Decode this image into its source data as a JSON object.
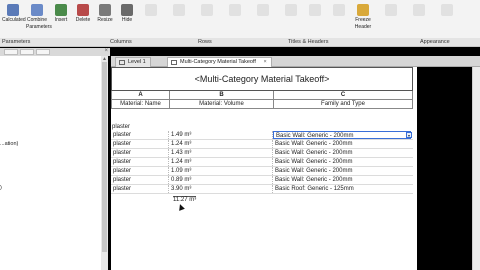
{
  "ribbon": {
    "buttons": [
      {
        "label": "Calculated",
        "color": "#5a7ab8",
        "dim": false
      },
      {
        "label": "Combine",
        "label2": "Parameters",
        "color": "#6a8ac8",
        "dim": false
      },
      {
        "label": "Insert",
        "color": "#4a8a4a",
        "dim": false
      },
      {
        "label": "Delete",
        "color": "#b84a4a",
        "dim": false
      },
      {
        "label": "Resize",
        "color": "#7a7a7a",
        "dim": false
      },
      {
        "label": "Hide",
        "color": "#6a6a6a",
        "dim": false
      },
      {
        "label": "",
        "color": "#c0c0c0",
        "dim": true
      },
      {
        "label": "",
        "color": "#c0c0c0",
        "dim": true
      },
      {
        "label": "",
        "color": "#c0c0c0",
        "dim": true
      },
      {
        "label": "",
        "color": "#c0c0c0",
        "dim": true
      },
      {
        "label": "",
        "color": "#c0c0c0",
        "dim": true
      },
      {
        "label": "",
        "color": "#c0c0c0",
        "dim": true
      },
      {
        "label": "",
        "color": "#c0c0c0",
        "dim": true
      },
      {
        "label": "",
        "color": "#c0c0c0",
        "dim": true
      },
      {
        "label": "Freeze",
        "label2": "Header",
        "color": "#d9a93a",
        "dim": false
      },
      {
        "label": "",
        "color": "#c0c0c0",
        "dim": true
      },
      {
        "label": "",
        "color": "#c0c0c0",
        "dim": true
      },
      {
        "label": "",
        "color": "#c0c0c0",
        "dim": true
      }
    ],
    "groups": [
      "Parameters",
      "Columns",
      "Rows",
      "Titles & Headers",
      "Appearance"
    ]
  },
  "tabs": [
    {
      "label": "Level 1",
      "active": false
    },
    {
      "label": "Multi-Category Material Takeoff",
      "active": true
    }
  ],
  "left_fragments": [
    "...ation)",
    ")"
  ],
  "schedule": {
    "title": "<Multi-Category Material Takeoff>",
    "col_letters": [
      "A",
      "B",
      "C"
    ],
    "headers": [
      "Material: Name",
      "Material: Volume",
      "Family and Type"
    ],
    "group_label": "plaster",
    "rows": [
      {
        "name": "plaster",
        "volume": "1.49 m³",
        "type": "Basic Wall: Generic - 200mm",
        "selected": true
      },
      {
        "name": "plaster",
        "volume": "1.24 m³",
        "type": "Basic Wall: Generic - 200mm",
        "selected": false
      },
      {
        "name": "plaster",
        "volume": "1.43 m³",
        "type": "Basic Wall: Generic - 200mm",
        "selected": false
      },
      {
        "name": "plaster",
        "volume": "1.24 m³",
        "type": "Basic Wall: Generic - 200mm",
        "selected": false
      },
      {
        "name": "plaster",
        "volume": "1.09 m³",
        "type": "Basic Wall: Generic - 200mm",
        "selected": false
      },
      {
        "name": "plaster",
        "volume": "0.89 m³",
        "type": "Basic Wall: Generic - 200mm",
        "selected": false
      },
      {
        "name": "plaster",
        "volume": "3.90 m³",
        "type": "Basic Roof: Generic - 125mm",
        "selected": false
      }
    ],
    "total": "11.27 m³"
  }
}
